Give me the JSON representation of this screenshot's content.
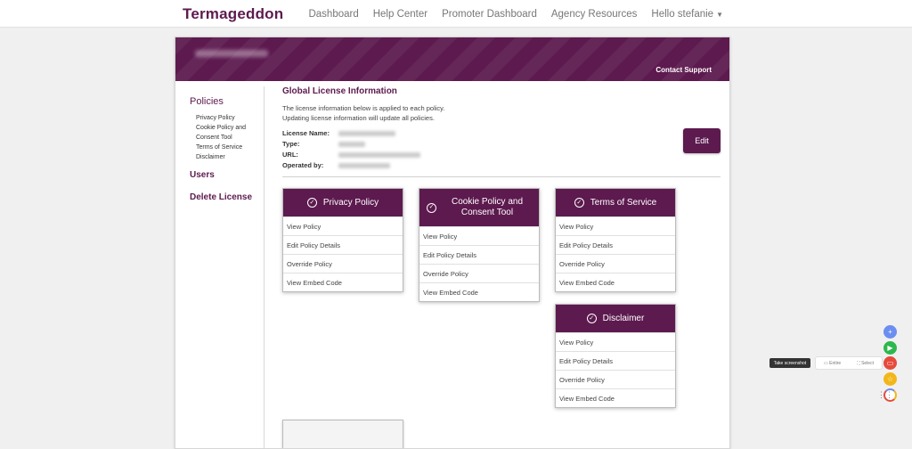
{
  "brand": "Termageddon",
  "nav": {
    "links": [
      "Dashboard",
      "Help Center",
      "Promoter Dashboard",
      "Agency Resources"
    ],
    "user": "Hello stefanie"
  },
  "banner": {
    "contact": "Contact Support"
  },
  "sidebar": {
    "policies_label": "Policies",
    "sub_items": [
      "Privacy Policy",
      "Cookie Policy and Consent Tool",
      "Terms of Service",
      "Disclaimer"
    ],
    "users_label": "Users",
    "delete_label": "Delete License"
  },
  "license": {
    "title": "Global License Information",
    "desc_line1": "The license information below is applied to each policy.",
    "desc_line2": "Updating license information will update all policies.",
    "fields": [
      {
        "label": "License Name:"
      },
      {
        "label": "Type:"
      },
      {
        "label": "URL:"
      },
      {
        "label": "Operated by:"
      }
    ],
    "edit_label": "Edit"
  },
  "policies": [
    {
      "title": "Privacy Policy",
      "items": [
        "View Policy",
        "Edit Policy Details",
        "Override Policy",
        "View Embed Code"
      ]
    },
    {
      "title": "Cookie Policy and Consent Tool",
      "items": [
        "View Policy",
        "Edit Policy Details",
        "Override Policy",
        "View Embed Code"
      ]
    },
    {
      "title": "Terms of Service",
      "items": [
        "View Policy",
        "Edit Policy Details",
        "Override Policy",
        "View Embed Code"
      ]
    },
    {
      "title": "Disclaimer",
      "items": [
        "View Policy",
        "Edit Policy Details",
        "Override Policy",
        "View Embed Code"
      ]
    }
  ],
  "widget": {
    "tooltip": "Take screenshot",
    "entire": "Entire",
    "select": "Select"
  },
  "colors": {
    "brand": "#5d1a4f",
    "fab_blue": "#6c8ef0",
    "fab_green": "#2db84d",
    "fab_red": "#e54b3c",
    "fab_yellow": "#f2b619"
  },
  "icons": [
    "check-circle-icon",
    "chevron-down-icon",
    "plus-icon",
    "play-icon",
    "screenshot-icon",
    "star-icon",
    "extension-logo-icon",
    "grip-icon"
  ]
}
